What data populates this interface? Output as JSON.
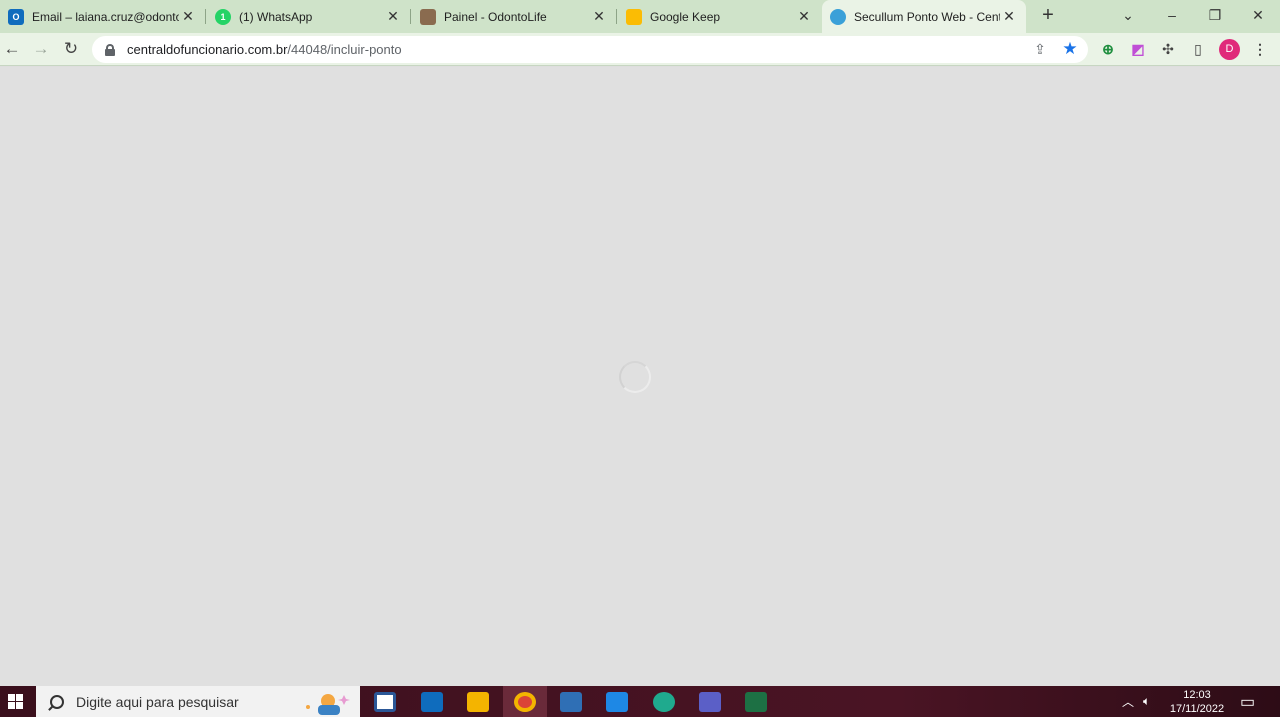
{
  "browser": {
    "tabs": [
      {
        "title": "Email – laiana.cruz@odontolife",
        "icon": "outlook-icon",
        "color": "#0f6cbd",
        "glyph": "0⃣"
      },
      {
        "title": "(1) WhatsApp",
        "icon": "whatsapp-icon",
        "color": "#25d366",
        "glyph": "1"
      },
      {
        "title": "Painel - OdontoLife",
        "icon": "odontolife-icon",
        "color": "#8a6b4f",
        "glyph": ""
      },
      {
        "title": "Google Keep",
        "icon": "google-keep-icon",
        "color": "#fbbc04",
        "glyph": ""
      },
      {
        "title": "Secullum Ponto Web - Central",
        "icon": "secullum-icon",
        "color": "#3aa0d8",
        "glyph": ""
      }
    ],
    "tab_close_glyph": "✕",
    "new_tab_glyph": "+",
    "window_controls": {
      "tab_search": "⌄",
      "minimize": "–",
      "restore": "❐",
      "close": "✕"
    },
    "address": {
      "host": "centraldofuncionario.com.br",
      "path": "/44048/incluir-ponto"
    },
    "profile_initial": "D",
    "accent": "#1a73e8"
  },
  "taskbar": {
    "search_placeholder": "Digite aqui para pesquisar",
    "time": "12:03",
    "date": "17/11/2022",
    "apps": [
      {
        "name": "microsoft-store-icon",
        "color": "#2b5797"
      },
      {
        "name": "mail-icon",
        "color": "#0f6cbd"
      },
      {
        "name": "file-explorer-icon",
        "color": "#f4b400"
      },
      {
        "name": "chrome-icon",
        "color": "#db4437"
      },
      {
        "name": "photos-icon",
        "color": "#2f6fb5"
      },
      {
        "name": "video-editor-icon",
        "color": "#1e88e5"
      },
      {
        "name": "edge-icon",
        "color": "#1faa8e"
      },
      {
        "name": "teams-icon",
        "color": "#5b5fc7"
      },
      {
        "name": "excel-icon",
        "color": "#1d7044"
      }
    ]
  }
}
